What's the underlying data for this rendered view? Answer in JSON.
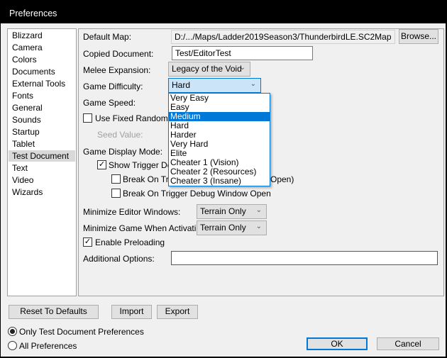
{
  "window": {
    "title": "Preferences"
  },
  "sidebar": {
    "items": [
      "Blizzard",
      "Camera",
      "Colors",
      "Documents",
      "External Tools",
      "Fonts",
      "General",
      "Sounds",
      "Startup",
      "Tablet",
      "Test Document",
      "Text",
      "Video",
      "Wizards"
    ],
    "selected": "Test Document"
  },
  "form": {
    "default_map_label": "Default Map:",
    "default_map_value": "D:/.../Maps/Ladder2019Season3/ThunderbirdLE.SC2Map",
    "browse": "Browse...",
    "copied_doc_label": "Copied Document:",
    "copied_doc_value": "Test/EditorTest",
    "melee_label": "Melee Expansion:",
    "melee_value": "Legacy of the Void",
    "difficulty_label": "Game Difficulty:",
    "difficulty_value": "Hard",
    "speed_label": "Game Speed:",
    "fixed_seed_label": "Use Fixed Random Se",
    "seed_label": "Seed Value:",
    "display_mode_label": "Game Display Mode:",
    "show_trigger_label": "Show Trigger Deb",
    "break_trigger_label": "Break On Trig",
    "break_trigger_tail": "Open)",
    "break_window_label": "Break On Trigger Debug Window Open",
    "min_editor_label": "Minimize Editor Windows:",
    "min_editor_value": "Terrain Only",
    "min_game_label": "Minimize Game When Activating:",
    "min_game_value": "Terrain Only",
    "preload_label": "Enable Preloading",
    "additional_label": "Additional Options:",
    "additional_value": ""
  },
  "dropdown": {
    "options": [
      "Very Easy",
      "Easy",
      "Medium",
      "Hard",
      "Harder",
      "Very Hard",
      "Elite",
      "Cheater 1 (Vision)",
      "Cheater 2 (Resources)",
      "Cheater 3 (Insane)"
    ],
    "highlighted": "Medium"
  },
  "buttons": {
    "reset": "Reset To Defaults",
    "import": "Import",
    "export": "Export",
    "ok": "OK",
    "cancel": "Cancel"
  },
  "scope": {
    "only": "Only Test Document Preferences",
    "all": "All Preferences"
  }
}
